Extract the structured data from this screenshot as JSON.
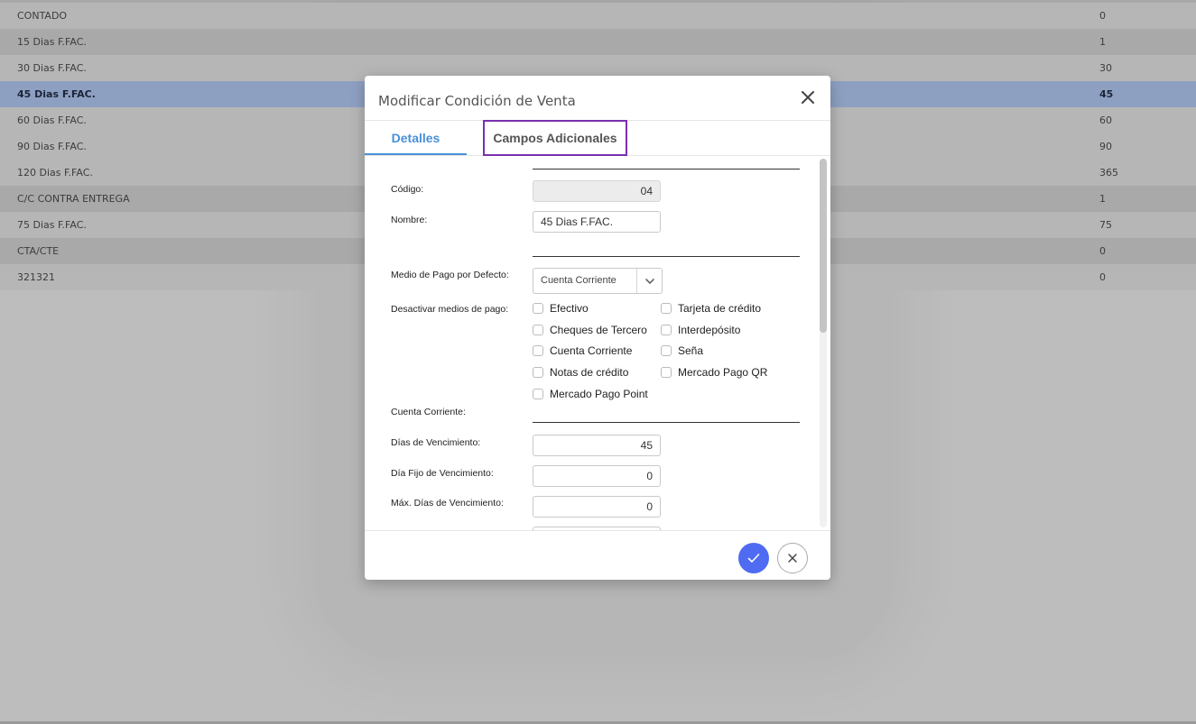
{
  "list": {
    "rows": [
      {
        "name": "CONTADO",
        "days": "0"
      },
      {
        "name": "15 Dias F.FAC.",
        "days": "1"
      },
      {
        "name": "30 Dias F.FAC.",
        "days": "30"
      },
      {
        "name": "45 Dias F.FAC.",
        "days": "45"
      },
      {
        "name": "60 Dias F.FAC.",
        "days": "60"
      },
      {
        "name": "90 Dias F.FAC.",
        "days": "90"
      },
      {
        "name": "120 Dias F.FAC.",
        "days": "365"
      },
      {
        "name": "C/C CONTRA ENTREGA",
        "days": "1"
      },
      {
        "name": "75 Dias F.FAC.",
        "days": "75"
      },
      {
        "name": "CTA/CTE",
        "days": "0"
      },
      {
        "name": "321321",
        "days": "0"
      }
    ]
  },
  "modal": {
    "title": "Modificar Condición de Venta",
    "tabs": {
      "detalles": "Detalles",
      "campos": "Campos Adicionales"
    },
    "fields": {
      "codigo_label": "Código:",
      "codigo_value": "04",
      "nombre_label": "Nombre:",
      "nombre_value": "45 Dias F.FAC.",
      "medio_label": "Medio de Pago por Defecto:",
      "medio_value": "Cuenta Corriente",
      "desactivar_label": "Desactivar medios de pago:",
      "cc_label": "Cuenta Corriente:",
      "dias_label": "Días de Vencimiento:",
      "dias_value": "45",
      "diafijo_label": "Día Fijo de Vencimiento:",
      "diafijo_value": "0",
      "maxdias_label": "Máx. Días de Vencimiento:",
      "maxdias_value": "0"
    },
    "payment_methods": {
      "efectivo": "Efectivo",
      "tarjeta": "Tarjeta de crédito",
      "cheques": "Cheques de Tercero",
      "interdeposito": "Interdepósito",
      "cuenta_corriente": "Cuenta Corriente",
      "sena": "Seña",
      "notas": "Notas de crédito",
      "mp_qr": "Mercado Pago QR",
      "mp_point": "Mercado Pago Point"
    }
  },
  "colors": {
    "accent": "#4a8fd8",
    "confirm": "#4e6bf2",
    "highlight": "#7a2fb0",
    "selected_row": "#8ea0c2"
  }
}
